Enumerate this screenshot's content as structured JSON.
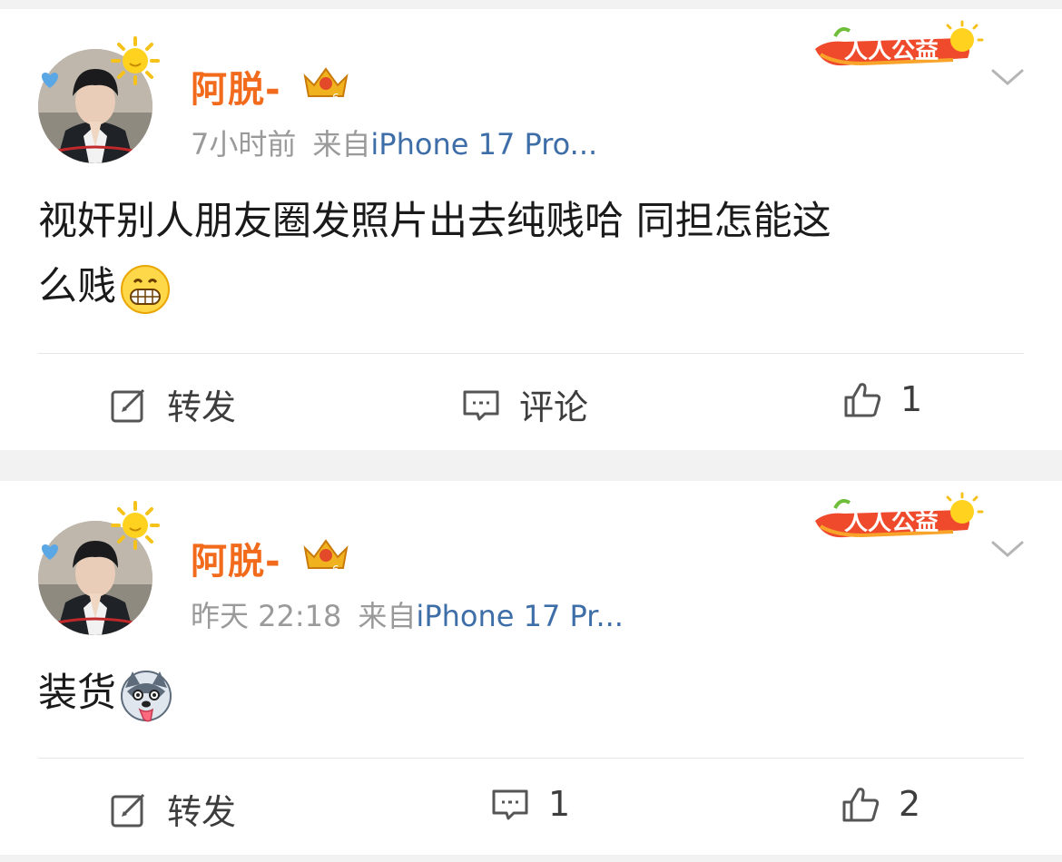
{
  "posts": [
    {
      "username": "阿脱-",
      "time": "7小时前",
      "source_prefix": "来自",
      "device": "iPhone 17 Pro...",
      "badge": "人人公益",
      "text_line1": "视奸别人朋友圈发照片出去纯贱哈 同担怎能这",
      "text_line2": "么贱",
      "emoji": "grinning-face",
      "actions": {
        "repost": "转发",
        "comment": "评论",
        "like": "1"
      }
    },
    {
      "username": "阿脱-",
      "time": "昨天 22:18",
      "source_prefix": "来自",
      "device": "iPhone 17 Pr...",
      "badge": "人人公益",
      "text_line1": "装货",
      "emoji": "husky-face",
      "actions": {
        "repost": "转发",
        "comment": "1",
        "like": "2"
      }
    }
  ],
  "colors": {
    "username": "#f26b1d",
    "device_link": "#3e6ea8",
    "meta": "#9a9a9a",
    "text": "#1a1a1a",
    "background": "#f2f2f2"
  }
}
